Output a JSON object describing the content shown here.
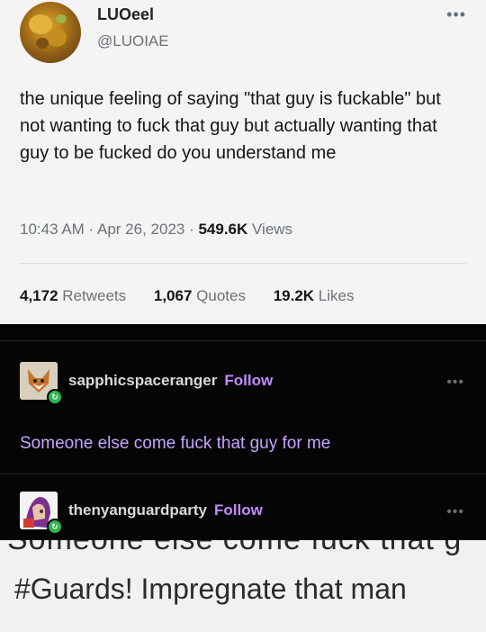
{
  "tweet": {
    "display_name": "LUOeel",
    "handle": "@LUOIAE",
    "more": "•••",
    "text": "the unique feeling of saying \"that guy is fuckable\" but not wanting to fuck that guy but actually wanting that guy to be fucked do you understand me",
    "time": "10:43 AM",
    "sep1": " · ",
    "date": "Apr 26, 2023",
    "sep2": " · ",
    "views_count": "549.6K",
    "views_label": " Views",
    "retweets_count": "4,172",
    "retweets_label": " Retweets",
    "quotes_count": "1,067",
    "quotes_label": " Quotes",
    "likes_count": "19.2K",
    "likes_label": " Likes"
  },
  "tumblr": {
    "posts": [
      {
        "username": "sapphicspaceranger",
        "follow_label": "Follow",
        "more": "•••",
        "body": "Someone else come fuck that guy for me"
      },
      {
        "username": "thenyanguardparty",
        "follow_label": "Follow",
        "more": "•••"
      }
    ]
  },
  "bottom": {
    "cut_text": "Someone else come fuck that g",
    "hashtag_text": "#Guards! Impregnate that man"
  },
  "colors": {
    "tumblr_follow": "#c28bff",
    "tumblr_body": "#c8a3ff",
    "twitter_muted": "#6b7278"
  }
}
